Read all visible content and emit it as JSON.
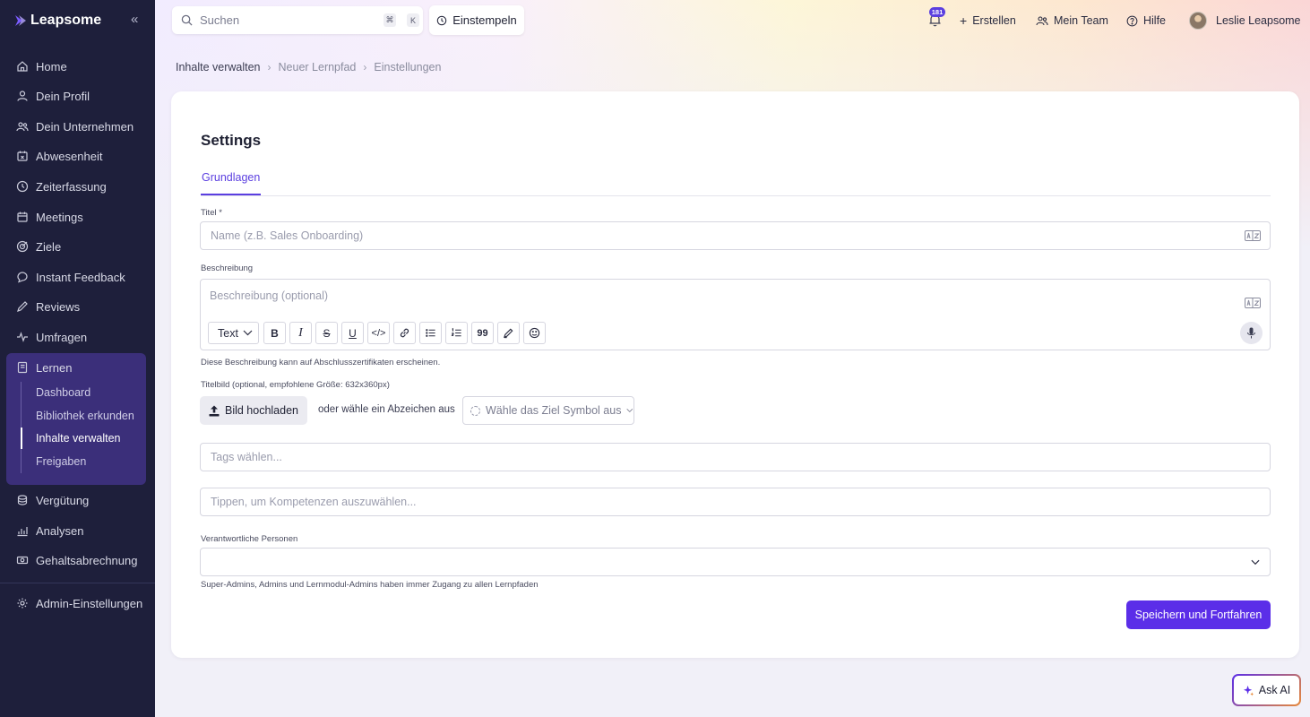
{
  "app": {
    "logo_text": "Leapsome"
  },
  "sidebar": {
    "items": [
      {
        "label": "Home",
        "icon": "home-icon"
      },
      {
        "label": "Dein Profil",
        "icon": "user-icon"
      },
      {
        "label": "Dein Unternehmen",
        "icon": "users-icon"
      },
      {
        "label": "Abwesenheit",
        "icon": "calendar-x-icon"
      },
      {
        "label": "Zeiterfassung",
        "icon": "clock-icon"
      },
      {
        "label": "Meetings",
        "icon": "calendar-icon"
      },
      {
        "label": "Ziele",
        "icon": "target-icon"
      },
      {
        "label": "Instant Feedback",
        "icon": "chat-icon"
      },
      {
        "label": "Reviews",
        "icon": "pen-icon"
      },
      {
        "label": "Umfragen",
        "icon": "pulse-icon"
      },
      {
        "label": "Lernen",
        "icon": "book-icon"
      },
      {
        "label": "Vergütung",
        "icon": "coins-icon"
      },
      {
        "label": "Analysen",
        "icon": "chart-icon"
      },
      {
        "label": "Gehaltsabrechnung",
        "icon": "cash-icon"
      },
      {
        "label": "Admin-Einstellungen",
        "icon": "gear-icon"
      }
    ],
    "sub_items": [
      {
        "label": "Dashboard"
      },
      {
        "label": "Bibliothek erkunden"
      },
      {
        "label": "Inhalte verwalten",
        "active": true
      },
      {
        "label": "Freigaben"
      }
    ]
  },
  "topbar": {
    "search_placeholder": "Suchen",
    "shortcut_keys": [
      "⌘",
      "K"
    ],
    "clock_in": "Einstempeln",
    "notifications_count": "181",
    "create": "Erstellen",
    "my_team": "Mein Team",
    "help": "Hilfe",
    "user_name": "Leslie Leapsome"
  },
  "breadcrumb": [
    "Inhalte verwalten",
    "Neuer Lernpfad",
    "Einstellungen"
  ],
  "form": {
    "title": "Settings",
    "tab": "Grundlagen",
    "title_label": "Titel *",
    "title_placeholder": "Name (z.B. Sales Onboarding)",
    "description_label": "Beschreibung",
    "description_placeholder": "Beschreibung (optional)",
    "text_style": "Text",
    "description_hint": "Diese Beschreibung kann auf Abschlusszertifikaten erscheinen.",
    "image_label": "Titelbild (optional, empfohlene Größe: 632x360px)",
    "upload_button": "Bild hochladen",
    "or_text": "oder wähle ein Abzeichen aus",
    "symbol_placeholder": "Wähle das Ziel Symbol aus",
    "tags_placeholder": "Tags wählen...",
    "skills_placeholder": "Tippen, um Kompetenzen auszuwählen...",
    "owners_label": "Verantwortliche Personen",
    "owners_hint": "Super-Admins, Admins und Lernmodul-Admins haben immer Zugang zu allen Lernpfaden",
    "save_button": "Speichern und Fortfahren"
  },
  "ask_ai": "Ask AI",
  "colors": {
    "sidebar_bg": "#1e1f3b",
    "accent": "#5b2ee8",
    "active_group": "#3b2f7a"
  }
}
